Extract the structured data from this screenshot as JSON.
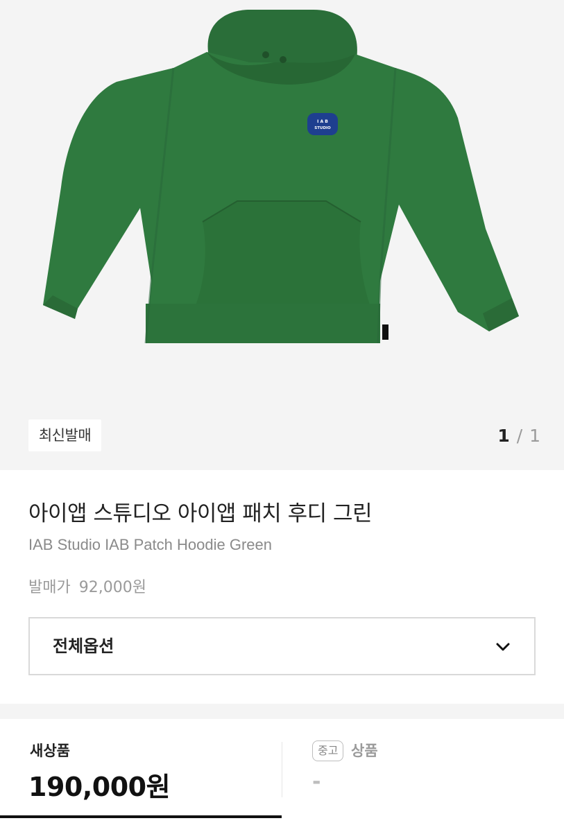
{
  "product_image": {
    "badge": "최신발매",
    "pager": {
      "current": "1",
      "separator": "/",
      "total": "1"
    },
    "patch_lines": [
      "I A B",
      "STUDIO"
    ],
    "colors": {
      "hoodie": "#2f7a3f",
      "patch": "#1e3f8f",
      "background": "#f4f4f4"
    }
  },
  "product": {
    "title_ko": "아이앱 스튜디오 아이앱 패치 후디 그린",
    "title_en": "IAB Studio IAB Patch Hoodie Green",
    "release_label": "발매가",
    "release_price": "92,000원"
  },
  "options": {
    "label": "전체옵션",
    "icon": "chevron-down-icon"
  },
  "price_tabs": {
    "new": {
      "label": "새상품",
      "price": "190,000원"
    },
    "used": {
      "chip": "중고",
      "label": "상품",
      "price": "-"
    }
  }
}
